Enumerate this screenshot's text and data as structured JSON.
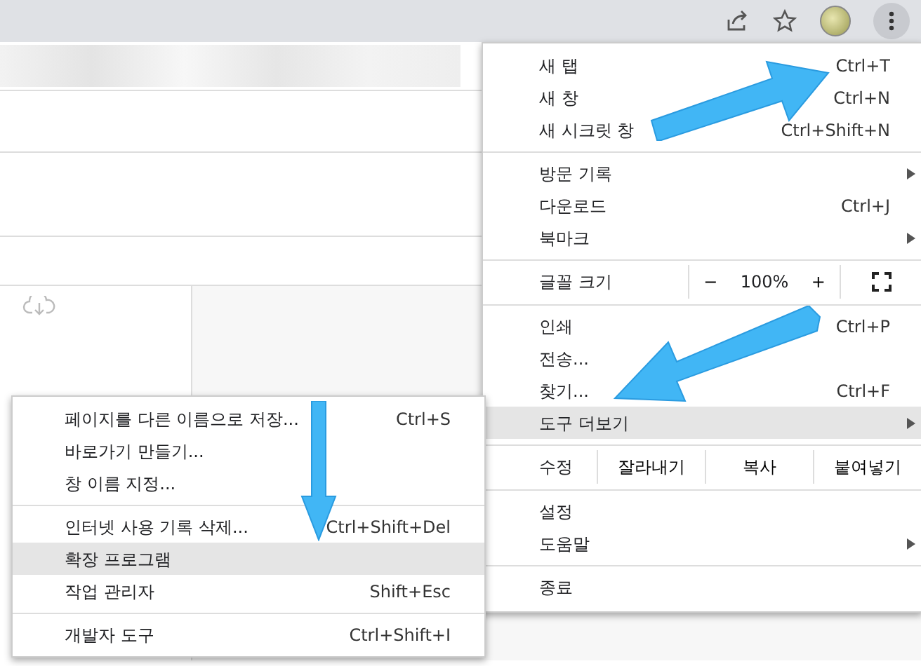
{
  "menu": {
    "items": [
      {
        "kind": "item",
        "label": "새 탭",
        "shortcut": "Ctrl+T",
        "submenu": false,
        "highlighted": false
      },
      {
        "kind": "item",
        "label": "새 창",
        "shortcut": "Ctrl+N",
        "submenu": false,
        "highlighted": false
      },
      {
        "kind": "item",
        "label": "새 시크릿 창",
        "shortcut": "Ctrl+Shift+N",
        "submenu": false,
        "highlighted": false
      },
      {
        "kind": "separator"
      },
      {
        "kind": "item",
        "label": "방문 기록",
        "submenu": true,
        "highlighted": false
      },
      {
        "kind": "item",
        "label": "다운로드",
        "shortcut": "Ctrl+J",
        "submenu": false,
        "highlighted": false
      },
      {
        "kind": "item",
        "label": "북마크",
        "submenu": true,
        "highlighted": false
      },
      {
        "kind": "separator"
      },
      {
        "kind": "zoom",
        "label": "글꼴 크기",
        "minus": "−",
        "value": "100%",
        "plus": "+"
      },
      {
        "kind": "separator"
      },
      {
        "kind": "item",
        "label": "인쇄",
        "shortcut": "Ctrl+P",
        "submenu": false,
        "highlighted": false
      },
      {
        "kind": "item",
        "label": "전송...",
        "submenu": false,
        "highlighted": false
      },
      {
        "kind": "item",
        "label": "찾기...",
        "shortcut": "Ctrl+F",
        "submenu": false,
        "highlighted": false
      },
      {
        "kind": "item",
        "label": "도구 더보기",
        "submenu": true,
        "highlighted": true
      },
      {
        "kind": "separator"
      },
      {
        "kind": "edit",
        "label": "수정",
        "buttons": [
          "잘라내기",
          "복사",
          "붙여넣기"
        ]
      },
      {
        "kind": "separator"
      },
      {
        "kind": "item",
        "label": "설정",
        "submenu": false,
        "highlighted": false
      },
      {
        "kind": "item",
        "label": "도움말",
        "submenu": true,
        "highlighted": false
      },
      {
        "kind": "separator"
      },
      {
        "kind": "item",
        "label": "종료",
        "submenu": false,
        "highlighted": false
      }
    ]
  },
  "submenu": {
    "items": [
      {
        "kind": "item",
        "label": "페이지를 다른 이름으로 저장...",
        "shortcut": "Ctrl+S",
        "highlighted": false
      },
      {
        "kind": "item",
        "label": "바로가기 만들기...",
        "highlighted": false
      },
      {
        "kind": "item",
        "label": "창 이름 지정...",
        "highlighted": false
      },
      {
        "kind": "separator"
      },
      {
        "kind": "item",
        "label": "인터넷 사용 기록 삭제...",
        "shortcut": "Ctrl+Shift+Del",
        "highlighted": false
      },
      {
        "kind": "item",
        "label": "확장 프로그램",
        "highlighted": true
      },
      {
        "kind": "item",
        "label": "작업 관리자",
        "shortcut": "Shift+Esc",
        "highlighted": false
      },
      {
        "kind": "separator"
      },
      {
        "kind": "item",
        "label": "개발자 도구",
        "shortcut": "Ctrl+Shift+I",
        "highlighted": false
      }
    ]
  }
}
